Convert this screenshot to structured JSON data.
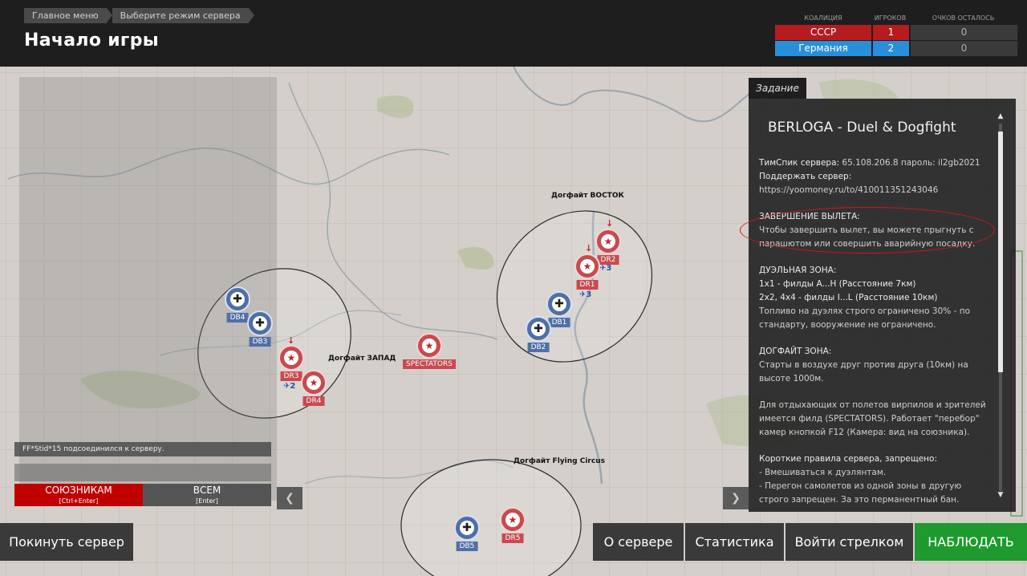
{
  "breadcrumb": [
    "Главное меню",
    "Выберите режим сервера"
  ],
  "page_title": "Начало игры",
  "scoreboard": {
    "headers": [
      "КОАЛИЦИЯ",
      "ИГРОКОВ",
      "ОЧКОВ ОСТАЛОСЬ"
    ],
    "rows": [
      {
        "name": "СССР",
        "players": "1",
        "points": "0",
        "color": "#b51c20"
      },
      {
        "name": "Германия",
        "players": "2",
        "points": "0",
        "color": "#2a8fd9"
      }
    ]
  },
  "map": {
    "zones": {
      "west": "Догфайт ЗАПАД",
      "east": "Догфайт ВОСТОК",
      "circus": "Догфайт Flying Circus"
    },
    "airfields": {
      "db4": "DB4",
      "db3": "DB3",
      "dr3": "DR3",
      "dr4": "DR4",
      "spectators": "SPECTATORS",
      "dr2": "DR2",
      "dr1": "DR1",
      "db1": "DB1",
      "db2": "DB2",
      "db5": "DB5",
      "dr5": "DR5"
    },
    "planes": {
      "west": "2",
      "east_dr2": "3",
      "east_dr1": "3"
    }
  },
  "chat": {
    "message": "FF*Stid*15 подсоединился к серверу.",
    "allies_button": "СОЮЗНИКАМ",
    "allies_hint": "[Ctrl+Enter]",
    "all_button": "ВСЕМ",
    "all_hint": "[Enter]"
  },
  "task": {
    "tab": "Задание",
    "title": "BERLOGA - Duel & Dogfight",
    "teamspeak_label": "ТимСпик сервера:",
    "teamspeak_value": "65.108.206.8 пароль: il2gb2021",
    "support_label": "Поддержать сервер:",
    "support_url": "https://yoomoney.ru/to/410011351243046",
    "finish_heading": "ЗАВЕРШЕНИЕ ВЫЛЕТА:",
    "finish_text": "Чтобы завершить вылет, вы можете прыгнуть с парашютом или совершить аварийную посадку.",
    "duel_heading": "ДУЭЛЬНАЯ ЗОНА:",
    "duel_line1": "1х1 - филды A...H (Расстояние 7км)",
    "duel_line2": "2х2, 4х4 - филды I...L (Расстояние 10км)",
    "duel_text": "Топливо на дуэлях строго ограничено 30% - по стандарту, вооружение не ограничено.",
    "dogfight_heading": "ДОГФАЙТ ЗОНА:",
    "dogfight_text": "Старты в воздухе друг против друга (10км) на высоте 1000м.",
    "rest_text": "Для отдыхающих от полетов вирпилов и зрителей имеется филд (SPECTATORS). Работает \"перебор\" камер кнопкой F12 (Камера: вид на союзника).",
    "rules_heading": "Короткие правила сервера, запрещено:",
    "rule1": " - Вмешиваться к дуэлянтам.",
    "rule2": " - Перегон самолетов из одной зоны в другую строго запрещен. За это перманентный бан."
  },
  "bottom": {
    "leave": "Покинуть сервер",
    "about": "О сервере",
    "stats": "Статистика",
    "gunner": "Войти стрелком",
    "observe": "НАБЛЮДАТЬ"
  },
  "colors": {
    "observe": "#1e9a2e",
    "allies": "#c00000",
    "all": "#555555"
  }
}
